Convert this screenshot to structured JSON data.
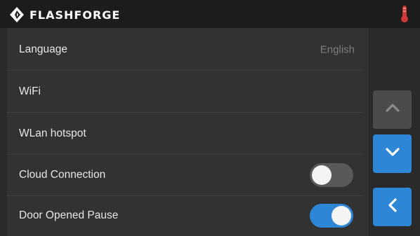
{
  "header": {
    "brand": "FLASHFORGE",
    "logo_icon": "flashforge-logo-icon",
    "status_icon": "thermometer-icon"
  },
  "settings": {
    "rows": [
      {
        "label": "Language",
        "value": "English"
      },
      {
        "label": "WiFi"
      },
      {
        "label": "WLan hotspot"
      },
      {
        "label": "Cloud Connection",
        "toggle": false
      },
      {
        "label": "Door Opened Pause",
        "toggle": true
      }
    ]
  },
  "nav": {
    "scroll_up_icon": "chevron-up-icon",
    "scroll_down_icon": "chevron-down-icon",
    "back_icon": "chevron-left-icon"
  },
  "colors": {
    "accent": "#2d86d6",
    "background": "#2a2a2b",
    "topbar": "#1c1c1d",
    "thermometer": "#d23a3a"
  }
}
